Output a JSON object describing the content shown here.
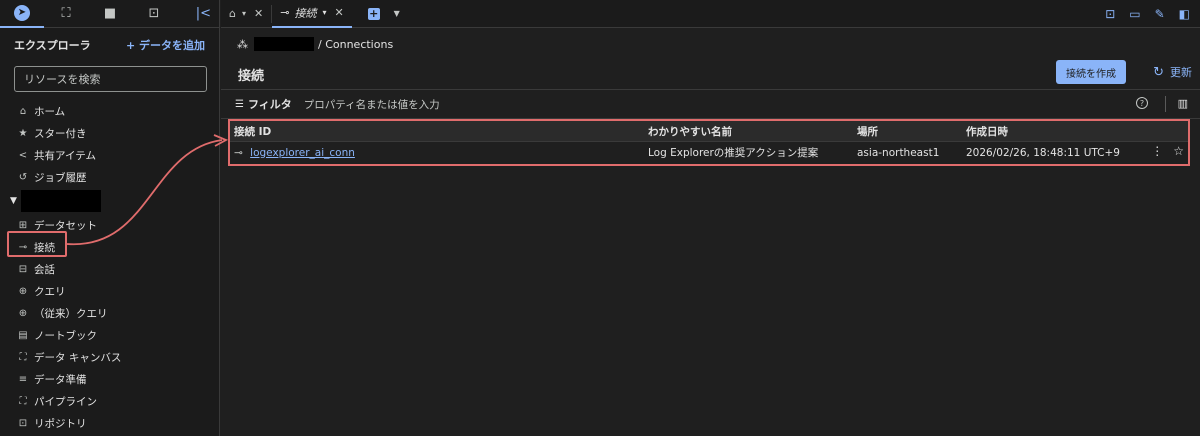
{
  "sidebar": {
    "explorer_title": "エクスプローラ",
    "add_data": "+ データを追加",
    "search_placeholder": "リソースを検索",
    "top_items": [
      {
        "icon": "home-icon",
        "label": "ホーム"
      },
      {
        "icon": "star-icon",
        "label": "スター付き"
      },
      {
        "icon": "share-icon",
        "label": "共有アイテム"
      },
      {
        "icon": "history-icon",
        "label": "ジョブ履歴"
      }
    ],
    "project_items": [
      {
        "icon": "dataset-icon",
        "label": "データセット"
      },
      {
        "icon": "connection-icon",
        "label": "接続"
      },
      {
        "icon": "conversation-icon",
        "label": "会話"
      },
      {
        "icon": "query-icon",
        "label": "クエリ"
      },
      {
        "icon": "legacy-query-icon",
        "label": "（従来）クエリ"
      },
      {
        "icon": "notebook-icon",
        "label": "ノートブック"
      },
      {
        "icon": "canvas-icon",
        "label": "データ キャンバス"
      },
      {
        "icon": "data-prep-icon",
        "label": "データ準備"
      },
      {
        "icon": "pipeline-icon",
        "label": "パイプライン"
      },
      {
        "icon": "repository-icon",
        "label": "リポジトリ"
      }
    ]
  },
  "tabs": {
    "active_label": "接続"
  },
  "main": {
    "breadcrumb": "/ Connections",
    "title": "接続",
    "create_button": "接続を作成",
    "refresh_button": "更新",
    "filter_label": "フィルタ",
    "filter_placeholder": "プロパティ名または値を入力",
    "columns": [
      "接続 ID",
      "わかりやすい名前",
      "場所",
      "作成日時"
    ],
    "rows": [
      {
        "id": "logexplorer_ai_conn",
        "friendly_name": "Log Explorerの推奨アクション提案",
        "location": "asia-northeast1",
        "created": "2026/02/26, 18:48:11 UTC+9"
      }
    ]
  },
  "colors": {
    "accent": "#8ab4f8",
    "highlight": "#e06c6c",
    "background": "#1f1f1f"
  }
}
